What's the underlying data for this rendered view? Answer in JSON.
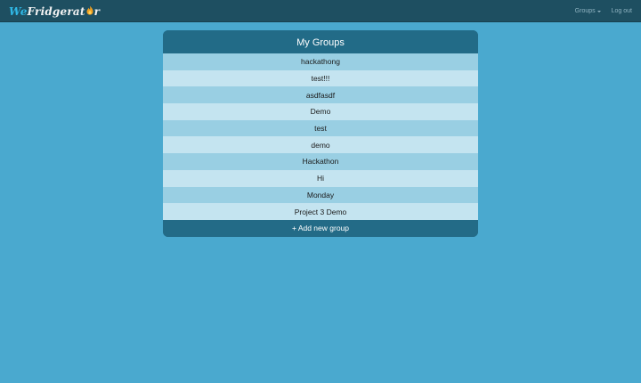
{
  "navbar": {
    "brand": {
      "part1": "We",
      "part2": "Fridgerat",
      "part3": "r"
    },
    "links": {
      "groups": "Groups",
      "logout": "Log out"
    }
  },
  "panel": {
    "title": "My Groups",
    "groups": [
      "hackathong",
      "test!!!",
      "asdfasdf",
      "Demo",
      "test",
      "demo",
      "Hackathon",
      "Hi",
      "Monday",
      "Project 3 Demo"
    ],
    "add_label": "+ Add new group"
  },
  "colors": {
    "background": "#4aa9cf",
    "navbar": "#1e4f61",
    "panel_header": "#236b87",
    "row_odd": "#99cfe3",
    "row_even": "#c4e4f0",
    "brand_accent": "#30b8e6",
    "flame": "#f0a020"
  }
}
